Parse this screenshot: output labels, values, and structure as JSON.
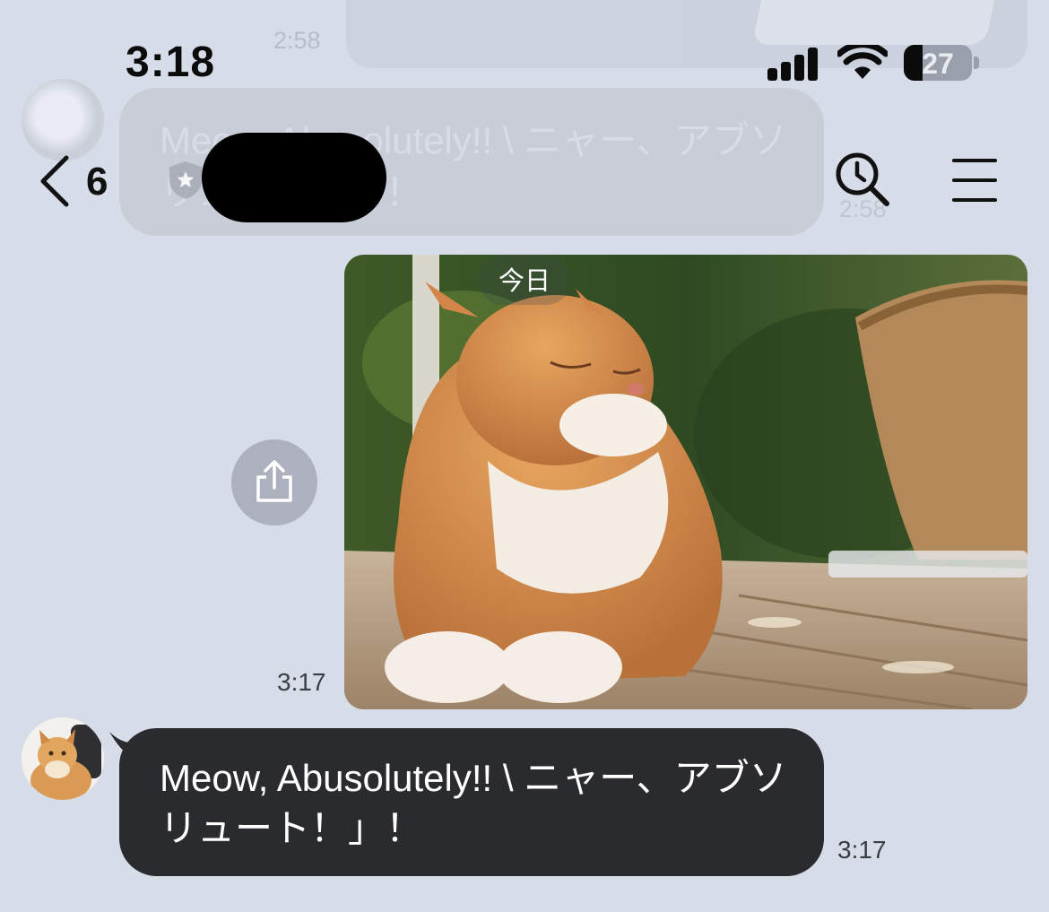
{
  "status_bar": {
    "time": "3:18",
    "battery_level": "27",
    "battery_fraction": 0.27
  },
  "background": {
    "previous_time": "2:58",
    "previous_message": "Meow, Abusolutely!! \\ ニャー、アブソリュート！」！",
    "previous_message_time": "2:58"
  },
  "nav": {
    "unread_count": "6"
  },
  "image_message": {
    "date_label": "今日",
    "time": "3:17"
  },
  "text_message": {
    "text": "Meow, Abusolutely!! \\ ニャー、アブソリュート！」！",
    "time": "3:17"
  },
  "colors": {
    "background": "#d6dce8",
    "incoming_bubble": "#2a2b2e",
    "share_button": "#acb1bd"
  },
  "icons": [
    "signal-icon",
    "wifi-icon",
    "battery-icon",
    "back-chevron-icon",
    "shield-star-icon",
    "clock-search-icon",
    "hamburger-menu-icon",
    "share-icon"
  ]
}
